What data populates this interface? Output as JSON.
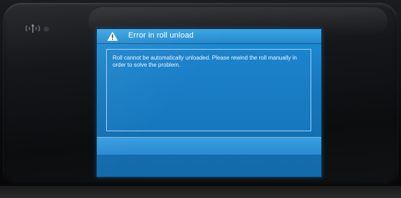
{
  "device": {
    "status_icons": {
      "wireless": "wifi-icon",
      "indicator": "status-led"
    }
  },
  "dialog": {
    "icon": "warning-icon",
    "title": "Error in roll unload",
    "message": "Roll cannot be automatically unloaded. Please rewind the roll manually in order to solve the problem."
  },
  "colors": {
    "screen_blue": "#1677bd",
    "title_blue": "#2488cc",
    "warning_triangle": "#ffffff",
    "bezel": "#16171a"
  }
}
